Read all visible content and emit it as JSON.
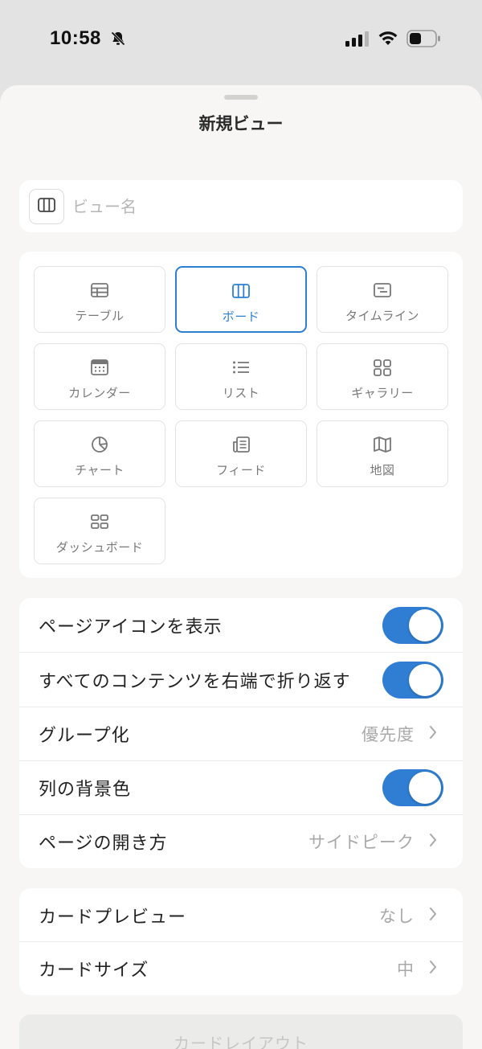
{
  "status_bar": {
    "time": "10:58"
  },
  "sheet": {
    "title": "新規ビュー"
  },
  "view_name": {
    "placeholder": "ビュー名",
    "value": ""
  },
  "layouts": [
    {
      "label": "テーブル",
      "icon": "table-icon",
      "selected": false
    },
    {
      "label": "ボード",
      "icon": "board-icon",
      "selected": true
    },
    {
      "label": "タイムライン",
      "icon": "timeline-icon",
      "selected": false
    },
    {
      "label": "カレンダー",
      "icon": "calendar-icon",
      "selected": false
    },
    {
      "label": "リスト",
      "icon": "list-icon",
      "selected": false
    },
    {
      "label": "ギャラリー",
      "icon": "gallery-icon",
      "selected": false
    },
    {
      "label": "チャート",
      "icon": "chart-icon",
      "selected": false
    },
    {
      "label": "フィード",
      "icon": "feed-icon",
      "selected": false
    },
    {
      "label": "地図",
      "icon": "map-icon",
      "selected": false
    },
    {
      "label": "ダッシュボード",
      "icon": "dashboard-icon",
      "selected": false
    }
  ],
  "settings": {
    "show_page_icon": {
      "label": "ページアイコンを表示",
      "on": true
    },
    "wrap_contents": {
      "label": "すべてのコンテンツを右端で折り返す",
      "on": true
    },
    "group_by": {
      "label": "グループ化",
      "value": "優先度"
    },
    "column_background": {
      "label": "列の背景色",
      "on": true
    },
    "open_pages_in": {
      "label": "ページの開き方",
      "value": "サイドピーク"
    }
  },
  "card_settings": {
    "card_preview": {
      "label": "カードプレビュー",
      "value": "なし"
    },
    "card_size": {
      "label": "カードサイズ",
      "value": "中"
    }
  },
  "card_layout": {
    "label": "カードレイアウト"
  },
  "colors": {
    "accent": "#2f7ed3",
    "sheet_bg": "#f7f6f4",
    "muted_text": "#a9a9a9"
  }
}
